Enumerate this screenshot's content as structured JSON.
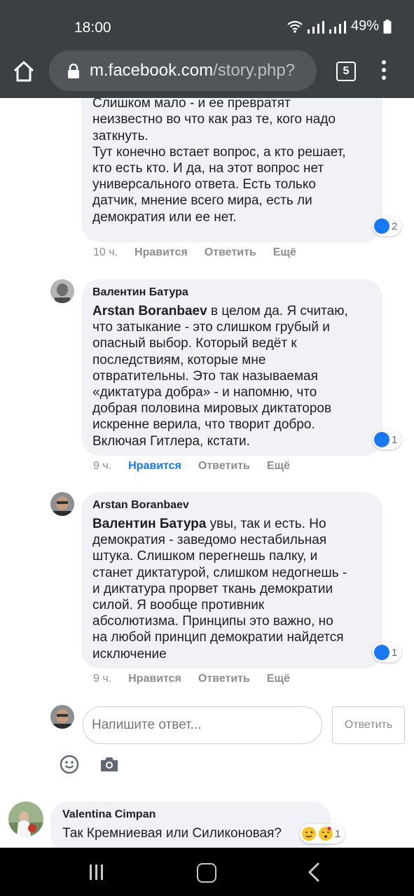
{
  "status_bar": {
    "time": "18:00",
    "battery": "49%"
  },
  "browser": {
    "url_host": "m.facebook.com",
    "url_path": "/story.php?",
    "tab_count": "5"
  },
  "comments": [
    {
      "text": "превращается в неизвестно что.\nСлишком мало - и ее превратят\nнеизвестно во что как раз те, кого надо\nзаткнуть.\nТут конечно встает вопрос, а кто решает,\nкто есть кто. И да, на этот вопрос нет\nуниверсального ответа. Есть только\nдатчик, мнение всего мира, есть ли\nдемократия или ее нет.",
      "reactions": "2",
      "time": "10 ч.",
      "like": "Нравится",
      "reply": "Ответить",
      "more": "Ещё"
    },
    {
      "author": "Валентин Батура",
      "mention": "Arstan Boranbaev",
      "text": " в целом да. Я считаю,\nчто затыкание - это слишком грубый и\nопасный выбор. Который ведёт к\nпоследствиям, которые мне\nотвратительны. Это так называемая\n«диктатура добра» - и напомню, что\nдобрая половина мировых диктаторов\nискренне верила, что творит добро.\nВключая Гитлера, кстати.",
      "reactions": "1",
      "time": "9 ч.",
      "like": "Нравится",
      "reply": "Ответить",
      "more": "Ещё"
    },
    {
      "author": "Arstan Boranbaev",
      "mention": "Валентин Батура",
      "text": " увы, так и есть. Но\nдемократия - заведомо нестабильная\nштука. Слишком перегнешь палку, и\nстанет диктатурой, слишком недогнешь -\nи диктатура прорвет ткань демократии\nсилой. Я вообще противник\nабсолютизма. Принципы это важно, но\nна любой принцип демократии найдется\nисключение",
      "reactions": "1",
      "time": "9 ч.",
      "like": "Нравится",
      "reply": "Ответить",
      "more": "Ещё"
    }
  ],
  "reply_box": {
    "placeholder": "Напишите ответ...",
    "button": "Ответить"
  },
  "bottom_comment": {
    "author": "Valentina Cimpan",
    "text": "Так Кремниевая или Силиконовая?",
    "reactions": "1"
  },
  "colors": {
    "accent": "#1877f2",
    "chrome": "#3c4043",
    "bubble": "#f0f2f5"
  }
}
